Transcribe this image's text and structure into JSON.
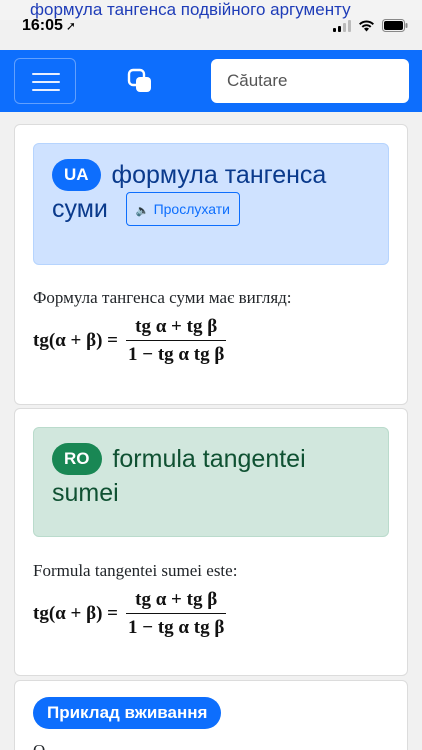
{
  "page_title_strip": "формула тангенса подвійного аргументу",
  "status_bar": {
    "time": "16:05",
    "location_glyph": "➚",
    "signal_icon": "cellular-signal-icon",
    "wifi_icon": "wifi-icon",
    "battery_icon": "battery-icon"
  },
  "navbar": {
    "menu_icon": "hamburger-menu-icon",
    "logo_icon": "app-logo-icon",
    "search_placeholder": "Căutare",
    "bg_color": "#0d6efd"
  },
  "entries": [
    {
      "lang_badge": "UA",
      "heading": "формула тангенса суми",
      "listen_label": "Прослухати",
      "description": "Формула тангенса суми має вигляд:",
      "formula": {
        "lhs": "tg(α + β) =",
        "numerator": "tg α + tg β",
        "denominator": "1 − tg α tg β"
      }
    },
    {
      "lang_badge": "RO",
      "heading": "formula tangentei sumei",
      "description": "Formula tangentei sumei este:",
      "formula": {
        "lhs": "tg(α + β) =",
        "numerator": "tg α + tg β",
        "denominator": "1 − tg α tg β"
      }
    }
  ],
  "example_section": {
    "button_label": "Приклад вживання",
    "partial_text": "О"
  }
}
